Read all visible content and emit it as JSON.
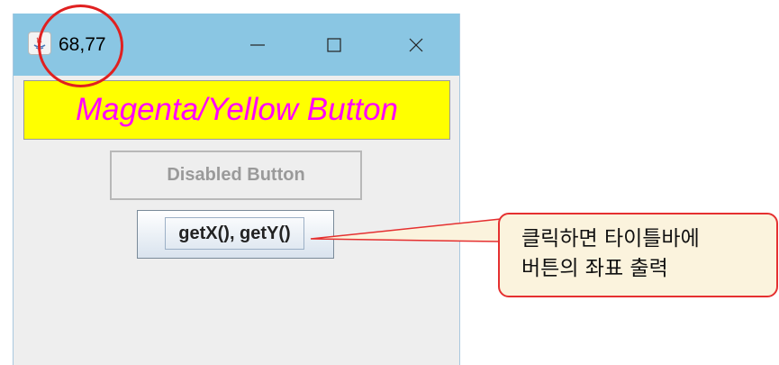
{
  "window": {
    "title": "68,77",
    "icon": "java-icon",
    "controls": {
      "minimize": "minimize-icon",
      "maximize": "maximize-icon",
      "close": "close-icon"
    }
  },
  "buttons": {
    "magenta_yellow": "Magenta/Yellow Button",
    "disabled": "Disabled Button",
    "getxy": "getX(), getY()"
  },
  "annotation": {
    "text": "클릭하면 타이틀바에\n버튼의 좌표 출력"
  },
  "colors": {
    "titlebar": "#8ac6e3",
    "magenta": "#ff00ff",
    "yellow": "#ffff00",
    "highlight_red": "#e02020",
    "callout_bg": "#fbf3dd"
  }
}
